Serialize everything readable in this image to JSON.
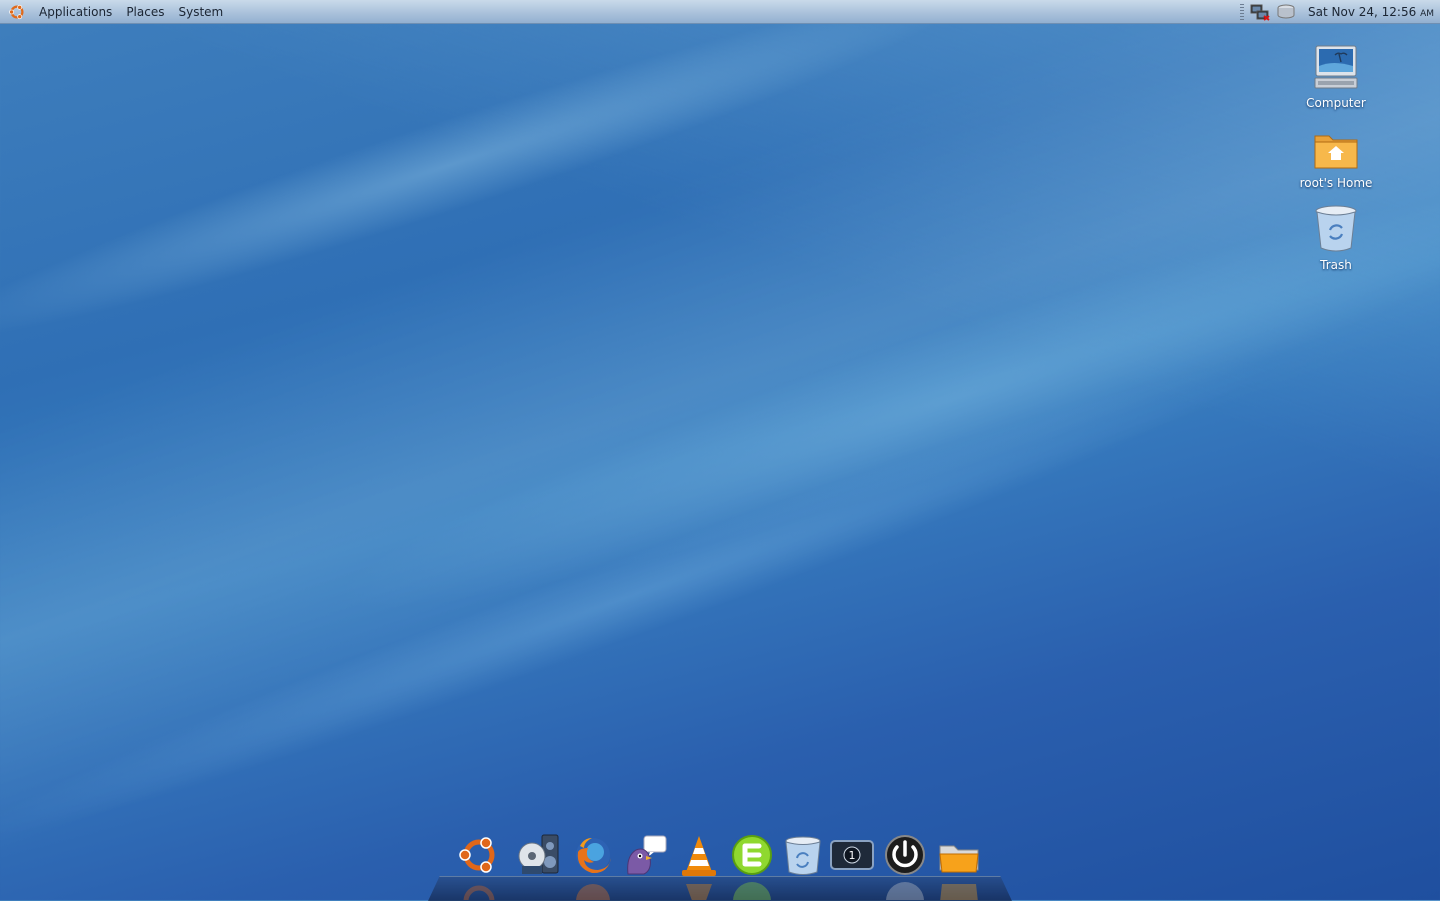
{
  "top_panel": {
    "menus": [
      "Applications",
      "Places",
      "System"
    ],
    "clock": "Sat Nov 24, 12:56",
    "clock_ampm": "AM"
  },
  "desktop_icons": [
    {
      "label": "Computer",
      "icon": "computer-icon"
    },
    {
      "label": "root's Home",
      "icon": "home-folder-icon"
    },
    {
      "label": "Trash",
      "icon": "trash-icon"
    }
  ],
  "dock": [
    {
      "icon": "ubuntu-icon"
    },
    {
      "icon": "media-player-icon"
    },
    {
      "icon": "firefox-icon"
    },
    {
      "icon": "pidgin-icon"
    },
    {
      "icon": "vlc-icon"
    },
    {
      "icon": "evernote-icon"
    },
    {
      "icon": "trash-icon"
    },
    {
      "icon": "workspace-switcher-icon"
    },
    {
      "icon": "power-icon"
    },
    {
      "icon": "folder-icon"
    }
  ],
  "colors": {
    "panel": "#a8c0da",
    "wallpaper": "#2f6fb5"
  }
}
